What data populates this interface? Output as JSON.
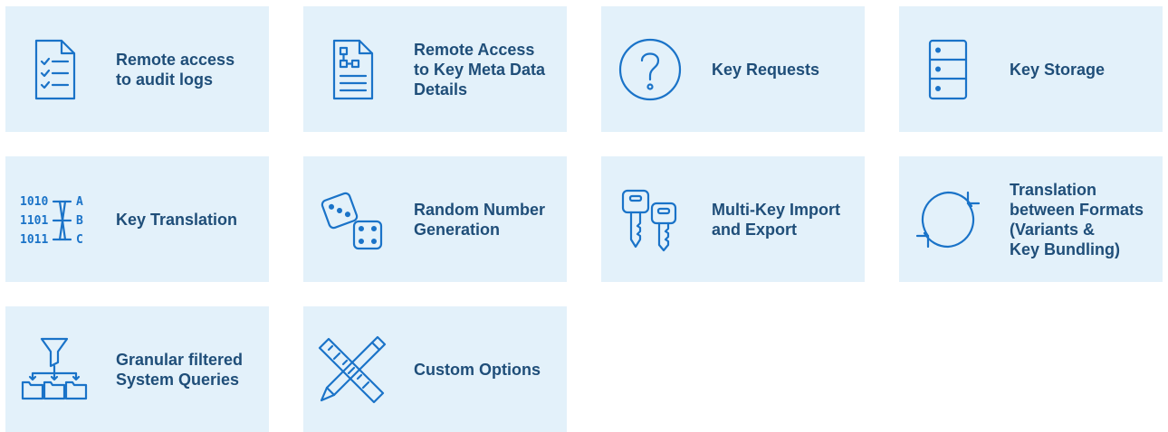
{
  "tiles": [
    {
      "label": "Remote access\nto audit logs",
      "icon": "checklist-document-icon"
    },
    {
      "label": "Remote Access\nto Key Meta Data\nDetails",
      "icon": "flowchart-document-icon"
    },
    {
      "label": "Key Requests",
      "icon": "question-mark-icon"
    },
    {
      "label": "Key Storage",
      "icon": "server-storage-icon"
    },
    {
      "label": "Key Translation",
      "icon": "binary-translation-icon"
    },
    {
      "label": "Random Number\nGeneration",
      "icon": "dice-icon"
    },
    {
      "label": "Multi-Key Import\nand Export",
      "icon": "keys-icon"
    },
    {
      "label": "Translation\nbetween Formats\n(Variants &\nKey Bundling)",
      "icon": "refresh-cycle-icon"
    },
    {
      "label": "Granular filtered\nSystem Queries",
      "icon": "funnel-folders-icon"
    },
    {
      "label": "Custom Options",
      "icon": "pencil-ruler-icon"
    }
  ],
  "icons": {
    "binary_rows": [
      "1010",
      "1101",
      "1011"
    ],
    "letters": [
      "A",
      "B",
      "C"
    ]
  },
  "colors": {
    "tile_background": "#e3f1fa",
    "icon": "#1a73c8",
    "text": "#1f4e79"
  }
}
